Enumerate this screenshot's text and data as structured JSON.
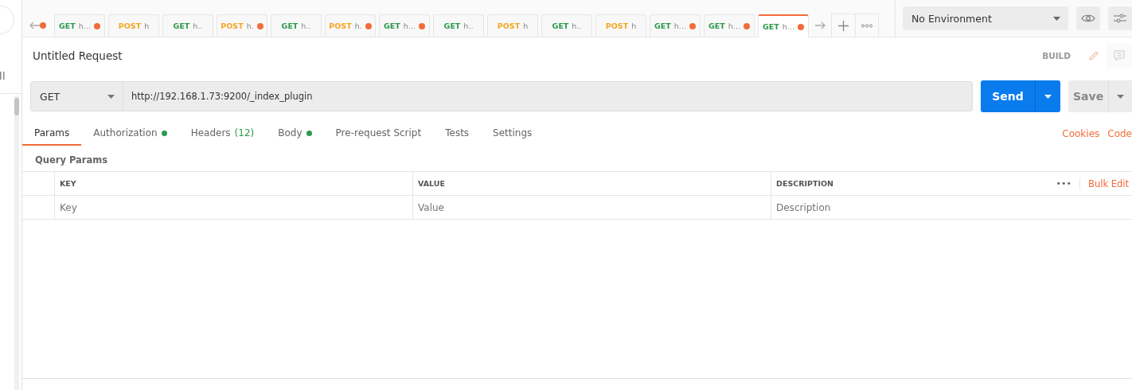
{
  "tabs": [
    {
      "kind": "partial",
      "unsaved": true,
      "selected": false
    },
    {
      "method": "GET",
      "label": "h...",
      "unsaved": true,
      "selected": false
    },
    {
      "method": "POST",
      "label": "h",
      "unsaved": false,
      "selected": false
    },
    {
      "method": "GET",
      "label": "h..",
      "unsaved": false,
      "selected": false
    },
    {
      "method": "POST",
      "label": "h.",
      "unsaved": true,
      "selected": false
    },
    {
      "method": "GET",
      "label": "h..",
      "unsaved": false,
      "selected": false
    },
    {
      "method": "POST",
      "label": "h.",
      "unsaved": true,
      "selected": false
    },
    {
      "method": "GET",
      "label": "h...",
      "unsaved": true,
      "selected": false
    },
    {
      "method": "GET",
      "label": "h..",
      "unsaved": false,
      "selected": false
    },
    {
      "method": "POST",
      "label": "h",
      "unsaved": false,
      "selected": false
    },
    {
      "method": "GET",
      "label": "h..",
      "unsaved": false,
      "selected": false
    },
    {
      "method": "POST",
      "label": "h",
      "unsaved": false,
      "selected": false
    },
    {
      "method": "GET",
      "label": "h...",
      "unsaved": true,
      "selected": false
    },
    {
      "method": "GET",
      "label": "h...",
      "unsaved": true,
      "selected": false
    },
    {
      "method": "GET",
      "label": "h...",
      "unsaved": true,
      "selected": true
    }
  ],
  "environment": {
    "value": "No Environment"
  },
  "request": {
    "title": "Untitled Request",
    "mode": "BUILD",
    "method": "GET",
    "url": "http://192.168.1.73:9200/_index_plugin",
    "send": "Send",
    "save": "Save"
  },
  "subtabs": [
    {
      "label": "Params",
      "selected": true,
      "dot": false
    },
    {
      "label": "Authorization",
      "selected": false,
      "dot": true
    },
    {
      "label": "Headers",
      "count": "(12)",
      "selected": false,
      "dot": false
    },
    {
      "label": "Body",
      "selected": false,
      "dot": true
    },
    {
      "label": "Pre-request Script",
      "selected": false,
      "dot": false
    },
    {
      "label": "Tests",
      "selected": false,
      "dot": false
    },
    {
      "label": "Settings",
      "selected": false,
      "dot": false
    }
  ],
  "links": [
    "Cookies",
    "Code"
  ],
  "query_params": {
    "title": "Query Params",
    "columns": [
      "KEY",
      "VALUE",
      "DESCRIPTION"
    ],
    "more": "•••",
    "bulk_edit": "Bulk Edit",
    "placeholders": [
      "Key",
      "Value",
      "Description"
    ]
  }
}
